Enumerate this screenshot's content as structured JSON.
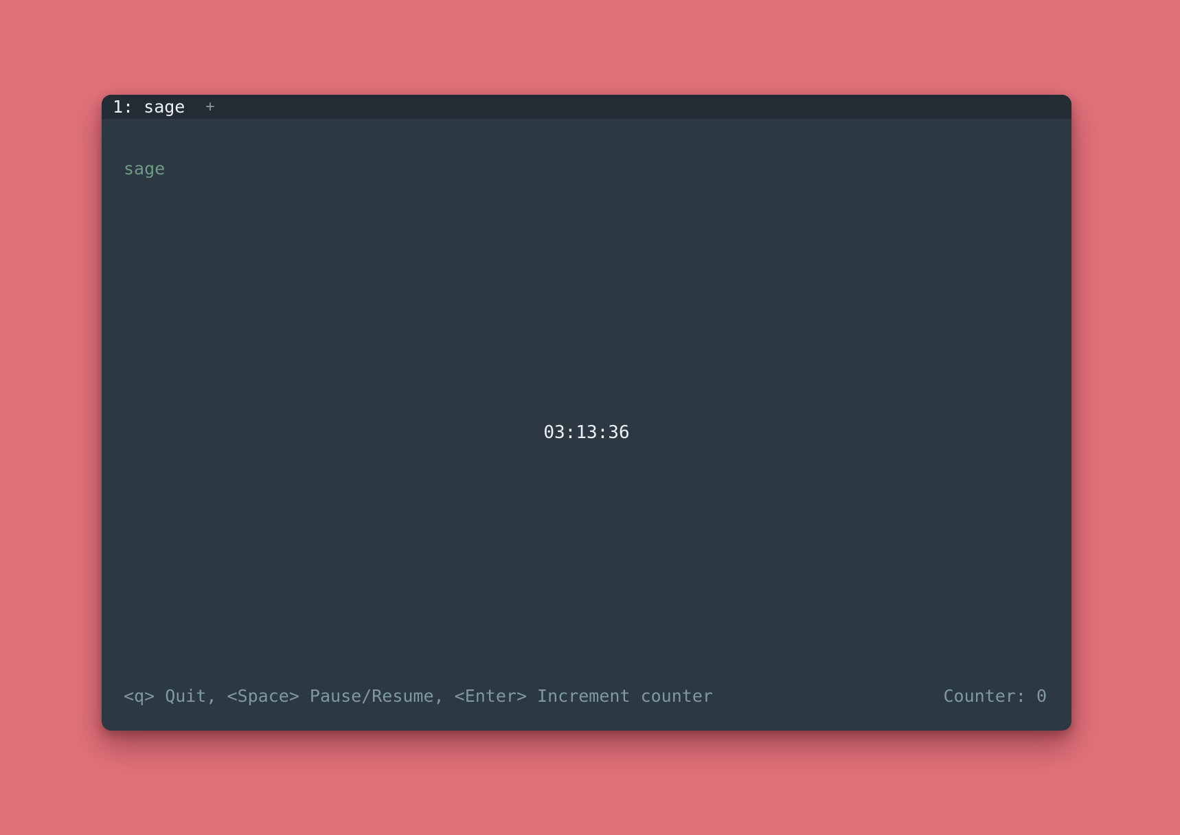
{
  "tabbar": {
    "active_tab": "1: sage",
    "new_tab": "+"
  },
  "app": {
    "title": "sage",
    "timer": "03:13:36"
  },
  "footer": {
    "help": "<q> Quit, <Space> Pause/Resume, <Enter> Increment counter",
    "counter": "Counter: 0"
  },
  "colors": {
    "background": "#e0727b",
    "window": "#2c3942",
    "tabbar": "#232c35",
    "title": "#6f9a86",
    "muted_text": "#7d9aa0",
    "bright_text": "#eef1f3"
  }
}
